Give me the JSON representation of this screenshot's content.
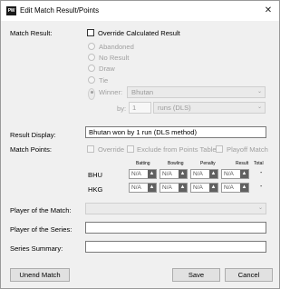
{
  "window": {
    "title": "Edit Match Result/Points",
    "close_glyph": "✕",
    "app_icon_text": "PW"
  },
  "match_result": {
    "label": "Match Result:",
    "override_label": "Override Calculated Result",
    "options": {
      "abandoned": "Abandoned",
      "no_result": "No Result",
      "draw": "Draw",
      "tie": "Tie",
      "winner": "Winner:"
    },
    "selected": "winner",
    "winner_value": "Bhutan",
    "by_label": "by:",
    "by_value": "1",
    "by_type": "runs (DLS)"
  },
  "result_display": {
    "label": "Result Display:",
    "value": "Bhutan won by 1 run (DLS method)"
  },
  "match_points": {
    "label": "Match Points:",
    "override_label": "Override",
    "exclude_label": "Exclude from Points Table",
    "playoff_label": "Playoff Match",
    "columns": {
      "batting": "Batting",
      "bowling": "Bowling",
      "penalty": "Penalty",
      "result": "Result",
      "total": "Total"
    },
    "rows": [
      {
        "team": "BHU",
        "batting": "N/A",
        "bowling": "N/A",
        "penalty": "N/A",
        "result": "N/A",
        "total": "-"
      },
      {
        "team": "HKG",
        "batting": "N/A",
        "bowling": "N/A",
        "penalty": "N/A",
        "result": "N/A",
        "total": "-"
      }
    ]
  },
  "player_of_match": {
    "label": "Player of the Match:",
    "value": ""
  },
  "player_of_series": {
    "label": "Player of the Series:",
    "value": ""
  },
  "series_summary": {
    "label": "Series Summary:",
    "value": ""
  },
  "buttons": {
    "unend": "Unend Match",
    "save": "Save",
    "cancel": "Cancel"
  },
  "icons": {
    "spin_up": "▲",
    "spin_down": "▼",
    "dropdown": "⌄"
  }
}
